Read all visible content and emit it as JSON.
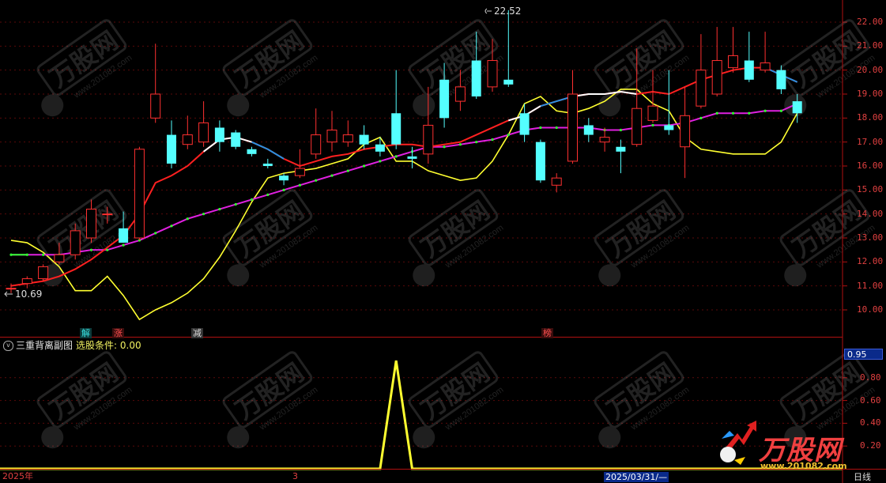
{
  "price_panel": {
    "y_axis": [
      "22.00",
      "21.00",
      "20.00",
      "19.00",
      "18.00",
      "17.00",
      "16.00",
      "15.00",
      "14.00",
      "13.00",
      "12.00",
      "11.00",
      "10.00"
    ],
    "high_label": "22.52",
    "low_label": "10.69",
    "event_tags": [
      {
        "text": "解",
        "color": "#39e3e3"
      },
      {
        "text": "涨",
        "color": "#ff5050"
      },
      {
        "text": "减",
        "color": "#dddddd"
      },
      {
        "text": "榜",
        "color": "#ff5050"
      }
    ]
  },
  "indicator_panel": {
    "name": "三重背离副图",
    "condition_label": "选股条件:",
    "condition_value": "0.00",
    "current_value": "0.95",
    "y_axis": [
      "0.80",
      "0.60",
      "0.40",
      "0.20"
    ]
  },
  "date_axis": {
    "start": "2025年",
    "month": "3",
    "cursor_date": "2025/03/31/—",
    "period": "日线"
  },
  "watermark": {
    "brand": "万股网",
    "url": "www.201082.com",
    "logo_domain": "www.201082.com"
  },
  "colors": {
    "up": "#ff3030",
    "down": "#54ffff",
    "ma_short": "#ff2020",
    "ma_mid": "#e020e0",
    "ma_long": "#ffff30",
    "indicator": "#ffff30",
    "axis": "#b01010"
  },
  "chart_data": {
    "type": "candlestick",
    "ylim": [
      9.6,
      22.6
    ],
    "candles": [
      {
        "o": 10.9,
        "c": 10.9,
        "h": 11.1,
        "l": 10.7
      },
      {
        "o": 11.1,
        "c": 11.3,
        "h": 11.4,
        "l": 10.9
      },
      {
        "o": 11.3,
        "c": 11.8,
        "h": 11.9,
        "l": 11.2
      },
      {
        "o": 12.0,
        "c": 12.3,
        "h": 12.8,
        "l": 11.9
      },
      {
        "o": 12.3,
        "c": 13.3,
        "h": 13.6,
        "l": 12.1
      },
      {
        "o": 13.0,
        "c": 14.2,
        "h": 14.6,
        "l": 12.8
      },
      {
        "o": 14.0,
        "c": 14.0,
        "h": 14.3,
        "l": 13.6
      },
      {
        "o": 13.4,
        "c": 12.8,
        "h": 14.1,
        "l": 12.8
      },
      {
        "o": 13.0,
        "c": 16.7,
        "h": 16.8,
        "l": 12.9
      },
      {
        "o": 18.0,
        "c": 19.0,
        "h": 21.1,
        "l": 17.8
      },
      {
        "o": 17.3,
        "c": 16.1,
        "h": 17.9,
        "l": 15.9
      },
      {
        "o": 16.9,
        "c": 17.3,
        "h": 18.1,
        "l": 16.7
      },
      {
        "o": 17.0,
        "c": 17.8,
        "h": 18.7,
        "l": 16.8
      },
      {
        "o": 17.6,
        "c": 17.0,
        "h": 17.9,
        "l": 16.6
      },
      {
        "o": 17.4,
        "c": 16.8,
        "h": 17.5,
        "l": 16.7
      },
      {
        "o": 16.7,
        "c": 16.5,
        "h": 16.8,
        "l": 16.4
      },
      {
        "o": 16.1,
        "c": 16.0,
        "h": 16.3,
        "l": 15.9
      },
      {
        "o": 15.6,
        "c": 15.4,
        "h": 15.7,
        "l": 15.2
      },
      {
        "o": 15.6,
        "c": 15.9,
        "h": 16.7,
        "l": 15.5
      },
      {
        "o": 16.5,
        "c": 17.3,
        "h": 18.4,
        "l": 16.3
      },
      {
        "o": 17.0,
        "c": 17.5,
        "h": 18.3,
        "l": 16.6
      },
      {
        "o": 17.0,
        "c": 17.3,
        "h": 17.9,
        "l": 16.8
      },
      {
        "o": 17.3,
        "c": 16.9,
        "h": 17.7,
        "l": 16.7
      },
      {
        "o": 16.9,
        "c": 16.6,
        "h": 17.2,
        "l": 16.4
      },
      {
        "o": 18.2,
        "c": 16.9,
        "h": 20.0,
        "l": 16.7
      },
      {
        "o": 16.4,
        "c": 16.3,
        "h": 16.8,
        "l": 15.9
      },
      {
        "o": 16.5,
        "c": 17.7,
        "h": 19.3,
        "l": 16.1
      },
      {
        "o": 19.6,
        "c": 18.0,
        "h": 20.3,
        "l": 17.6
      },
      {
        "o": 18.7,
        "c": 19.3,
        "h": 20.0,
        "l": 18.3
      },
      {
        "o": 20.4,
        "c": 18.9,
        "h": 21.6,
        "l": 18.8
      },
      {
        "o": 19.3,
        "c": 20.4,
        "h": 21.3,
        "l": 19.1
      },
      {
        "o": 19.6,
        "c": 19.4,
        "h": 22.5,
        "l": 19.3
      },
      {
        "o": 18.2,
        "c": 17.3,
        "h": 18.6,
        "l": 17.0
      },
      {
        "o": 17.0,
        "c": 15.4,
        "h": 17.1,
        "l": 15.3
      },
      {
        "o": 15.2,
        "c": 15.5,
        "h": 15.7,
        "l": 14.9
      },
      {
        "o": 16.2,
        "c": 19.0,
        "h": 20.0,
        "l": 16.1
      },
      {
        "o": 17.7,
        "c": 17.3,
        "h": 18.0,
        "l": 17.0
      },
      {
        "o": 17.0,
        "c": 17.2,
        "h": 17.6,
        "l": 16.6
      },
      {
        "o": 16.8,
        "c": 16.6,
        "h": 17.1,
        "l": 15.7
      },
      {
        "o": 16.9,
        "c": 18.4,
        "h": 20.9,
        "l": 16.8
      },
      {
        "o": 17.9,
        "c": 18.5,
        "h": 20.0,
        "l": 17.8
      },
      {
        "o": 17.7,
        "c": 17.5,
        "h": 20.0,
        "l": 17.3
      },
      {
        "o": 16.8,
        "c": 18.1,
        "h": 19.3,
        "l": 15.5
      },
      {
        "o": 18.5,
        "c": 20.0,
        "h": 21.5,
        "l": 18.4
      },
      {
        "o": 19.0,
        "c": 20.4,
        "h": 21.8,
        "l": 18.9
      },
      {
        "o": 20.1,
        "c": 20.6,
        "h": 21.8,
        "l": 19.9
      },
      {
        "o": 20.4,
        "c": 19.6,
        "h": 21.6,
        "l": 19.5
      },
      {
        "o": 20.0,
        "c": 20.3,
        "h": 21.6,
        "l": 19.9
      },
      {
        "o": 20.0,
        "c": 19.2,
        "h": 20.2,
        "l": 19.0
      },
      {
        "o": 18.7,
        "c": 18.2,
        "h": 19.0,
        "l": 17.8
      }
    ],
    "series": [
      {
        "values": [
          11.0,
          11.1,
          11.2,
          11.4,
          11.7,
          12.1,
          12.6,
          13.1,
          14.0,
          15.3,
          15.6,
          16.0,
          16.6,
          17.1,
          17.2,
          17.0,
          16.7,
          16.3,
          16.0,
          16.2,
          16.4,
          16.5,
          16.7,
          16.8,
          16.9,
          16.9,
          16.8,
          16.9,
          17.0,
          17.3,
          17.6,
          17.9,
          18.1,
          18.5,
          18.7,
          18.9,
          19.0,
          19.0,
          19.1,
          19.0,
          19.1,
          19.0,
          19.3,
          19.6,
          19.8,
          20.0,
          20.1,
          20.1,
          19.8,
          19.5
        ]
      },
      {
        "values": [
          12.3,
          12.3,
          12.3,
          12.3,
          12.4,
          12.5,
          12.5,
          12.7,
          12.9,
          13.2,
          13.5,
          13.8,
          14.0,
          14.2,
          14.4,
          14.6,
          14.8,
          15.0,
          15.2,
          15.4,
          15.6,
          15.8,
          16.0,
          16.2,
          16.4,
          16.6,
          16.8,
          16.8,
          16.9,
          17.0,
          17.1,
          17.3,
          17.5,
          17.6,
          17.6,
          17.6,
          17.6,
          17.5,
          17.5,
          17.6,
          17.7,
          17.7,
          17.8,
          18.0,
          18.2,
          18.2,
          18.2,
          18.3,
          18.3,
          18.6
        ]
      },
      {
        "values": [
          12.9,
          12.8,
          12.4,
          11.8,
          10.8,
          10.8,
          11.4,
          10.6,
          9.6,
          10.0,
          10.3,
          10.7,
          11.3,
          12.2,
          13.3,
          14.5,
          15.5,
          15.7,
          15.8,
          15.9,
          16.1,
          16.3,
          16.9,
          17.2,
          16.2,
          16.2,
          15.8,
          15.6,
          15.4,
          15.5,
          16.2,
          17.3,
          18.6,
          18.9,
          18.3,
          18.2,
          18.4,
          18.7,
          19.2,
          19.2,
          18.6,
          18.3,
          17.2,
          16.7,
          16.6,
          16.5,
          16.5,
          16.5,
          17.0,
          18.2
        ]
      }
    ],
    "indicator": {
      "ylim": [
        0,
        1
      ],
      "values": [
        0,
        0,
        0,
        0,
        0,
        0,
        0,
        0,
        0,
        0,
        0,
        0,
        0,
        0,
        0,
        0,
        0,
        0,
        0,
        0,
        0,
        0,
        0,
        0,
        0.95,
        0,
        0,
        0,
        0,
        0,
        0,
        0,
        0,
        0,
        0,
        0,
        0,
        0,
        0,
        0,
        0,
        0,
        0,
        0,
        0,
        0,
        0,
        0,
        0,
        0
      ]
    }
  }
}
